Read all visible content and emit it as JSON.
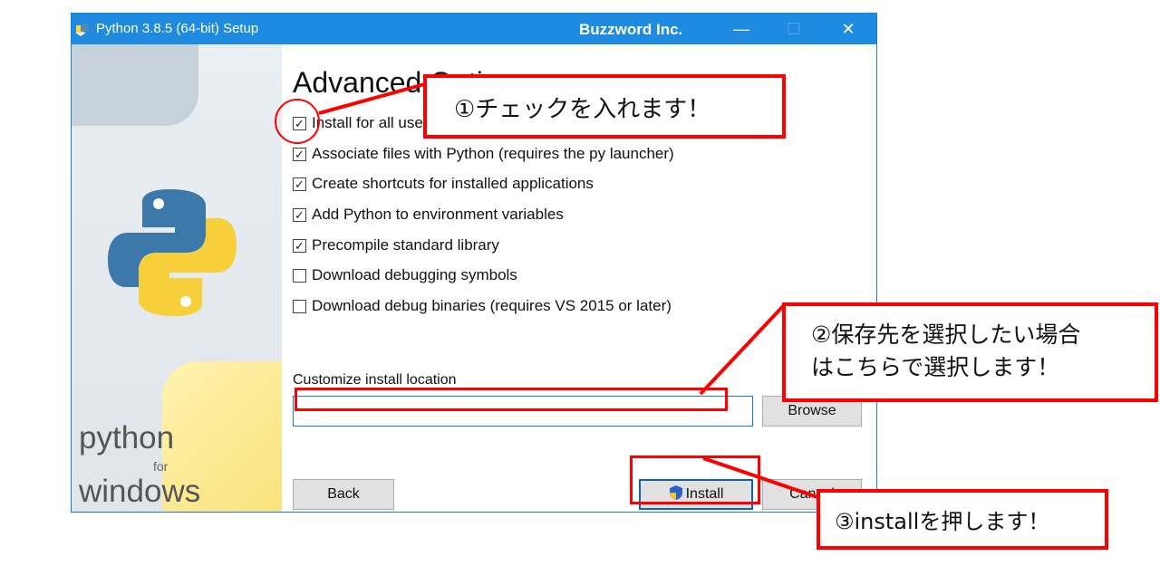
{
  "window": {
    "title": "Python 3.8.5 (64-bit) Setup",
    "publisher": "Buzzword Inc.",
    "minimize_glyph": "—",
    "maximize_glyph": "☐",
    "close_glyph": "✕",
    "accent_color": "#1e8ae0"
  },
  "sidebar": {
    "brand_line1": "python",
    "brand_line2": "for",
    "brand_line3": "windows"
  },
  "main": {
    "heading": "Advanced Options",
    "options": [
      {
        "label": "Install for all users",
        "checked": true
      },
      {
        "label": "Associate files with Python (requires the py launcher)",
        "checked": true
      },
      {
        "label": "Create shortcuts for installed applications",
        "checked": true
      },
      {
        "label": "Add Python to environment variables",
        "checked": true
      },
      {
        "label": "Precompile standard library",
        "checked": true
      },
      {
        "label": "Download debugging symbols",
        "checked": false
      },
      {
        "label": "Download debug binaries (requires VS 2015 or later)",
        "checked": false
      }
    ],
    "location_label": "Customize install location",
    "location_value": "",
    "browse_label": "Browse",
    "back_label": "Back",
    "install_label": "Install",
    "cancel_label": "Cancel"
  },
  "annotations": {
    "step1": "①チェックを入れます！",
    "step2_line1": "②保存先を選択したい場合",
    "step2_line2": "はこちらで選択します！",
    "step3": "③installを押します！",
    "highlight_color": "#ff0000"
  }
}
